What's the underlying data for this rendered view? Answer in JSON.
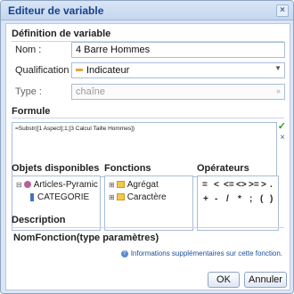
{
  "dialog": {
    "title": "Editeur de variable"
  },
  "definition": {
    "heading": "Définition de variable",
    "name_label": "Nom :",
    "name_value": "4 Barre Hommes",
    "qualification_label": "Qualification :",
    "qualification_value": "Indicateur",
    "type_label": "Type :",
    "type_value": "chaîne"
  },
  "formula": {
    "heading": "Formule",
    "text": "=Substr([1 Aspect];1;[3 Calcul Taille Hommes])"
  },
  "objects": {
    "heading": "Objets disponibles",
    "items": [
      "Articles-Pyramic",
      "CATEGORIE"
    ]
  },
  "functions": {
    "heading": "Fonctions",
    "items": [
      "Agrégat",
      "Caractère"
    ]
  },
  "operators": {
    "heading": "Opérateurs",
    "row1": [
      "=",
      "<",
      "<=",
      "<>",
      ">=",
      ">",
      "."
    ],
    "row2": [
      "+",
      "-",
      "/",
      "*",
      ";",
      "(",
      ")"
    ]
  },
  "description": {
    "heading": "Description",
    "text": "NomFonction(type paramètres)",
    "info_link": "Informations supplémentaires sur cette fonction."
  },
  "buttons": {
    "ok": "OK",
    "cancel": "Annuler"
  }
}
